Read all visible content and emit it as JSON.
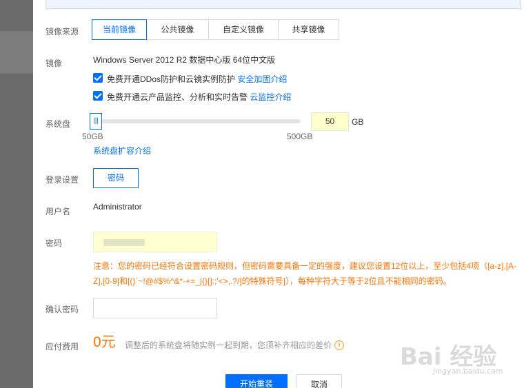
{
  "form": {
    "image_source": {
      "label": "镜像来源",
      "tabs": [
        {
          "label": "当前镜像",
          "active": true
        },
        {
          "label": "公共镜像",
          "active": false
        },
        {
          "label": "自定义镜像",
          "active": false
        },
        {
          "label": "共享镜像",
          "active": false
        }
      ]
    },
    "image": {
      "label": "镜像",
      "value": "Windows Server 2012 R2 数据中心版 64位中文版",
      "option1_text": "免费开通DDos防护和云镜实例防护",
      "option1_link": "安全加固介绍",
      "option2_text": "免费开通云产品监控、分析和实时告警",
      "option2_link": "云监控介绍"
    },
    "system_disk": {
      "label": "系统盘",
      "value": "50",
      "unit": "GB",
      "min_label": "50GB",
      "max_label": "500GB",
      "slider_fraction": 0.0,
      "link": "系统盘扩容介绍"
    },
    "login": {
      "label": "登录设置",
      "button": "密码"
    },
    "username": {
      "label": "用户名",
      "value": "Administrator"
    },
    "password": {
      "label": "密码",
      "warning": "注意：您的密码已经符合设置密码规则，但密码需要具备一定的强度，建议您设置12位以上，至少包括4项（[a-z],[A-Z],[0-9]和[()`~!@#$%^&*-+=_|{}[]:;'<>,.?/]的特殊符号]），每种字符大于等于2位且不能相同的密码。"
    },
    "confirm_password": {
      "label": "确认密码"
    },
    "fee": {
      "label": "应付费用",
      "amount": "0元",
      "note": "调整后的系统盘将随实例一起到期，您须补齐相应的差价"
    },
    "actions": {
      "submit": "开始重装",
      "cancel": "取消"
    }
  },
  "watermark": {
    "text": "Bai 经验",
    "sub": "jingyan.baidu.com"
  },
  "colors": {
    "accent": "#006eff",
    "warning": "#ff7200",
    "highlight": "#ffffcc"
  }
}
